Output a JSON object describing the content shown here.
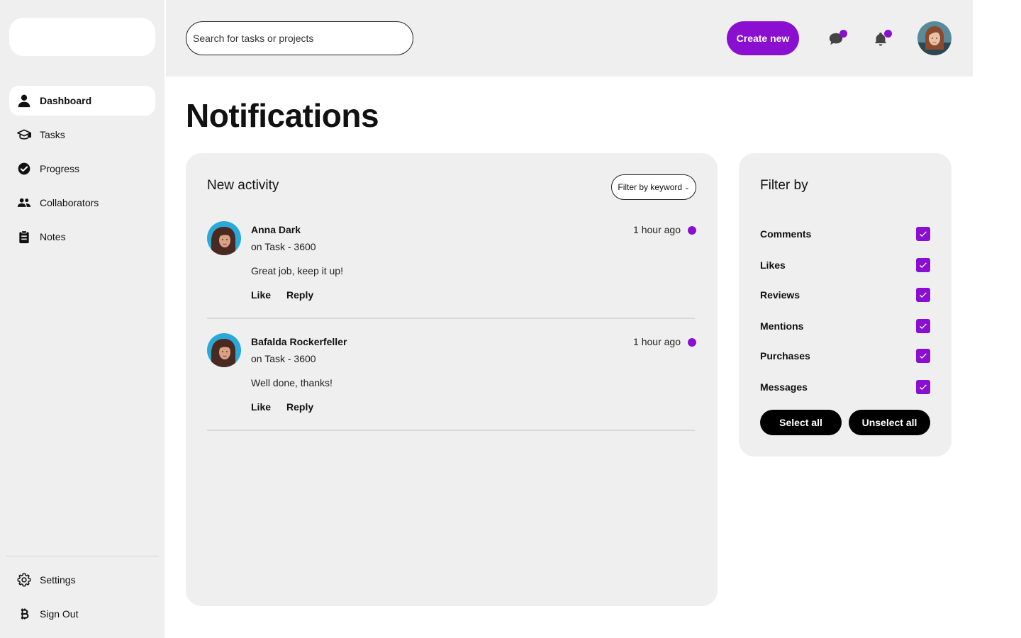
{
  "sidebar": {
    "items": [
      {
        "label": "Dashboard",
        "icon": "user-icon"
      },
      {
        "label": "Tasks",
        "icon": "graduation-cap-icon"
      },
      {
        "label": "Progress",
        "icon": "check-circle-icon"
      },
      {
        "label": "Collaborators",
        "icon": "users-icon"
      },
      {
        "label": "Notes",
        "icon": "clipboard-icon"
      }
    ],
    "bottom": [
      {
        "label": "Settings",
        "icon": "gear-icon"
      },
      {
        "label": "Sign Out",
        "icon": "bitcoin-icon"
      }
    ]
  },
  "header": {
    "search_placeholder": "Search for tasks or projects",
    "create_label": "Create new"
  },
  "page": {
    "title": "Notifications"
  },
  "activity": {
    "title": "New activity",
    "filter_label": "Filter by keyword",
    "items": [
      {
        "name": "Anna Dark",
        "sub": "on Task - 3600",
        "time": "1 hour ago",
        "message": "Great job, keep it up!",
        "like": "Like",
        "reply": "Reply"
      },
      {
        "name": "Bafalda Rockerfeller",
        "sub": "on Task - 3600",
        "time": "1 hour ago",
        "message": "Well done, thanks!",
        "like": "Like",
        "reply": "Reply"
      }
    ]
  },
  "filters": {
    "title": "Filter by",
    "options": [
      {
        "label": "Comments",
        "checked": true
      },
      {
        "label": "Likes",
        "checked": true
      },
      {
        "label": "Reviews",
        "checked": true
      },
      {
        "label": "Mentions",
        "checked": true
      },
      {
        "label": "Purchases",
        "checked": true
      },
      {
        "label": "Messages",
        "checked": true
      }
    ],
    "select_all": "Select all",
    "unselect_all": "Unselect all"
  },
  "colors": {
    "accent": "#8a0fd0",
    "panel": "#efefef",
    "dark_button": "#000000"
  }
}
